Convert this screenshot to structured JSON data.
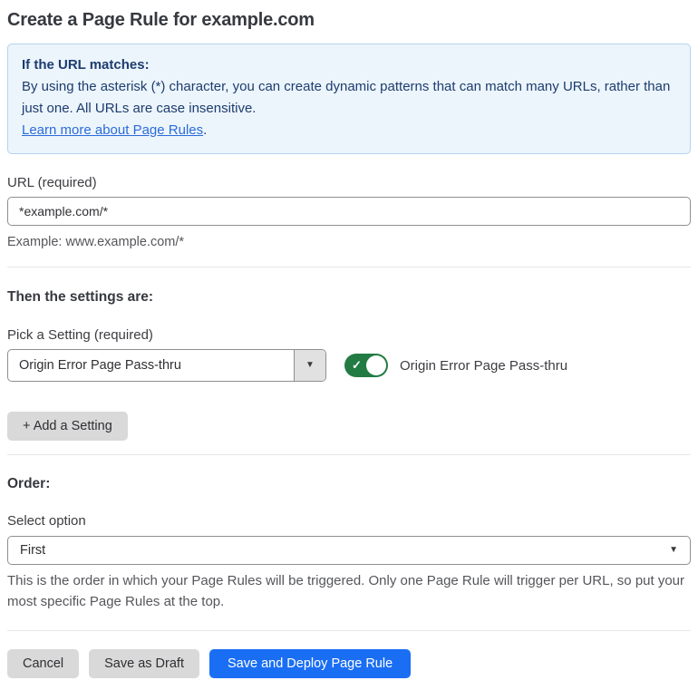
{
  "page": {
    "title": "Create a Page Rule for example.com"
  },
  "info_box": {
    "heading": "If the URL matches:",
    "body": "By using the asterisk (*) character, you can create dynamic patterns that can match many URLs, rather than just one. All URLs are case insensitive.",
    "link_label": "Learn more about Page Rules",
    "link_suffix": "."
  },
  "url_field": {
    "label": "URL (required)",
    "value": "*example.com/*",
    "helper": "Example: www.example.com/*"
  },
  "settings_section": {
    "heading": "Then the settings are:",
    "picker_label": "Pick a Setting (required)",
    "picker_value": "Origin Error Page Pass-thru",
    "toggle_label": "Origin Error Page Pass-thru",
    "toggle_state": "on",
    "add_setting_label": "+ Add a Setting"
  },
  "order_section": {
    "heading": "Order:",
    "select_label": "Select option",
    "select_value": "First",
    "helper": "This is the order in which your Page Rules will be triggered. Only one Page Rule will trigger per URL, so put your most specific Page Rules at the top."
  },
  "footer": {
    "cancel_label": "Cancel",
    "save_draft_label": "Save as Draft",
    "save_deploy_label": "Save and Deploy Page Rule"
  },
  "icons": {
    "picker_caret": "▼",
    "select_caret": "▼",
    "toggle_check": "✓"
  },
  "colors": {
    "accent_blue": "#1a6ef3",
    "toggle_green": "#237b44",
    "info_box_bg": "#ecf5fc",
    "info_box_border": "#b3d4ef",
    "info_box_text": "#1d3c6e",
    "link_blue": "#2c6bd9",
    "button_gray": "#d9d9d9"
  }
}
